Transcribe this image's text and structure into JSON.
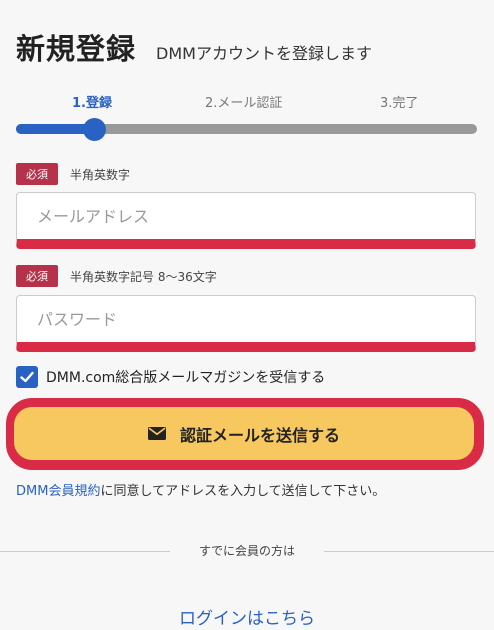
{
  "header": {
    "title": "新規登録",
    "subtitle": "DMMアカウントを登録します"
  },
  "steps": [
    {
      "label": "1.登録",
      "active": true
    },
    {
      "label": "2.メール認証",
      "active": false
    },
    {
      "label": "3.完了",
      "active": false
    }
  ],
  "progress": {
    "current_step": 1,
    "total_steps": 3,
    "fraction": 0.17
  },
  "email_field": {
    "required_label": "必須",
    "hint": "半角英数字",
    "placeholder": "メールアドレス",
    "value": ""
  },
  "password_field": {
    "required_label": "必須",
    "hint": "半角英数字記号 8〜36文字",
    "placeholder": "パスワード",
    "value": ""
  },
  "newsletter": {
    "label": "DMM.com総合版メールマガジンを受信する",
    "checked": true
  },
  "submit": {
    "label": "認証メールを送信する",
    "icon": "envelope-icon"
  },
  "terms": {
    "link_text": "DMM会員規約",
    "text": "に同意してアドレスを入力して送信して下さい。"
  },
  "existing_member": {
    "divider_text": "すでに会員の方は",
    "login_link": "ログインはこちら"
  },
  "colors": {
    "accent_blue": "#2a62c4",
    "error_red": "#d92b46",
    "required_badge": "#b5324a",
    "button_yellow": "#f6c85f"
  }
}
